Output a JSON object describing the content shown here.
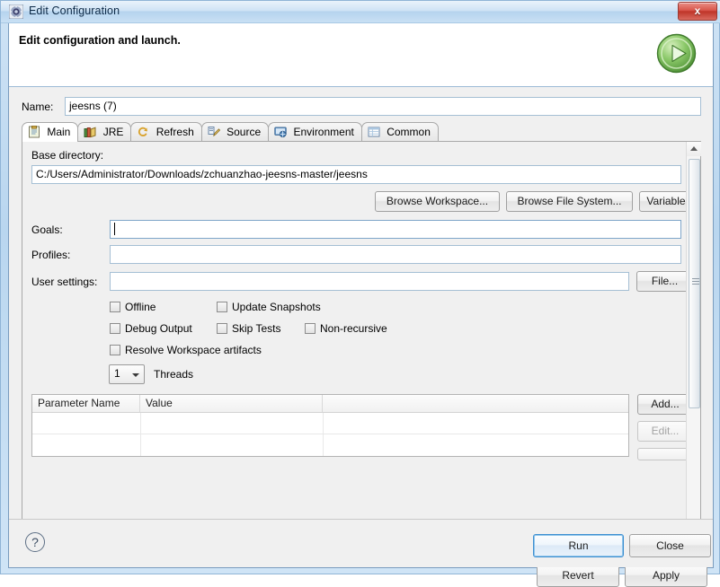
{
  "window": {
    "title": "Edit Configuration",
    "title_icon": "gear-icon",
    "close_label": "x"
  },
  "header": {
    "title": "Edit configuration and launch.",
    "run_icon": "green-play-icon"
  },
  "name": {
    "label": "Name:",
    "value": "jeesns (7)"
  },
  "tabs": [
    {
      "label": "Main",
      "icon": "clipboard-icon",
      "active": true
    },
    {
      "label": "JRE",
      "icon": "books-icon",
      "active": false
    },
    {
      "label": "Refresh",
      "icon": "refresh-icon",
      "active": false
    },
    {
      "label": "Source",
      "icon": "source-pencil-icon",
      "active": false
    },
    {
      "label": "Environment",
      "icon": "environment-icon",
      "active": false
    },
    {
      "label": "Common",
      "icon": "common-icon",
      "active": false
    }
  ],
  "main_tab": {
    "base_directory": {
      "label": "Base directory:",
      "value": "C:/Users/Administrator/Downloads/zchuanzhao-jeesns-master/jeesns"
    },
    "browse_buttons": [
      "Browse Workspace...",
      "Browse File System...",
      "Variables..."
    ],
    "goals": {
      "label": "Goals:",
      "value": ""
    },
    "profiles": {
      "label": "Profiles:",
      "value": ""
    },
    "user_settings": {
      "label": "User settings:",
      "value": "",
      "button": "File..."
    },
    "checkboxes": [
      {
        "label": "Offline",
        "checked": false
      },
      {
        "label": "Update Snapshots",
        "checked": false
      },
      {
        "label": "Debug Output",
        "checked": false
      },
      {
        "label": "Skip Tests",
        "checked": false
      },
      {
        "label": "Non-recursive",
        "checked": false
      },
      {
        "label": "Resolve Workspace artifacts",
        "checked": false
      }
    ],
    "threads": {
      "value": "1",
      "label": "Threads"
    },
    "parameters_table": {
      "columns": [
        "Parameter Name",
        "Value"
      ],
      "rows": [
        {
          "name": "",
          "value": ""
        },
        {
          "name": "",
          "value": ""
        }
      ]
    },
    "table_buttons": [
      {
        "label": "Add...",
        "enabled": true
      },
      {
        "label": "Edit...",
        "enabled": false
      }
    ]
  },
  "actions": {
    "revert": "Revert",
    "apply": "Apply"
  },
  "footer": {
    "help": "?",
    "run": "Run",
    "close": "Close"
  }
}
